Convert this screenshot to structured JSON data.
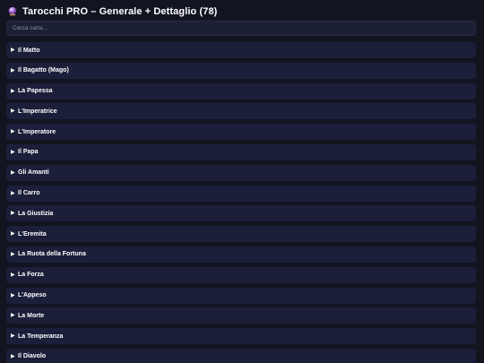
{
  "header": {
    "title": "Tarocchi PRO – Generale + Dettaglio (78)",
    "icon": "crystal-ball-icon"
  },
  "search": {
    "placeholder": "Cerca carta..."
  },
  "cards": [
    {
      "label": "Il Matto"
    },
    {
      "label": "Il Bagatto (Mago)"
    },
    {
      "label": "La Papessa"
    },
    {
      "label": "L'Imperatrice"
    },
    {
      "label": "L'Imperatore"
    },
    {
      "label": "Il Papa"
    },
    {
      "label": "Gli Amanti"
    },
    {
      "label": "Il Carro"
    },
    {
      "label": "La Giustizia"
    },
    {
      "label": "L'Eremita"
    },
    {
      "label": "La Ruota della Fortuna"
    },
    {
      "label": "La Forza"
    },
    {
      "label": "L'Appeso"
    },
    {
      "label": "La Morte"
    },
    {
      "label": "La Temperanza"
    },
    {
      "label": "Il Diavolo"
    }
  ],
  "colors": {
    "background": "#121420",
    "row": "#1c1f3a",
    "text": "#ffffff"
  }
}
